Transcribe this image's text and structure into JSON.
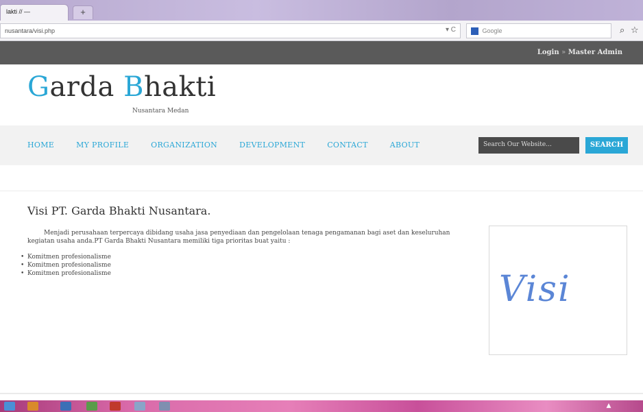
{
  "browser": {
    "tab_title": "lakti // —",
    "new_tab_label": "+",
    "url": "nusantara/visi.php",
    "url_controls": "▾ C",
    "search_placeholder": "Google",
    "search_engine_icon": "google-icon",
    "icons": [
      "find-icon",
      "star-icon"
    ]
  },
  "topbar": {
    "login_label": "Login",
    "separator": "»",
    "user_label": "Master Admin"
  },
  "header": {
    "brand_first_cap": "G",
    "brand_first_rest": "arda ",
    "brand_second_cap": "B",
    "brand_second_rest": "hakti",
    "tagline": "Nusantara Medan"
  },
  "menu": {
    "items": [
      "HOME",
      "MY PROFILE",
      "ORGANIZATION",
      "DEVELOPMENT",
      "CONTACT",
      "ABOUT"
    ]
  },
  "site_search": {
    "placeholder": "Search Our Website...",
    "button": "SEARCH"
  },
  "content": {
    "title": "Visi PT. Garda Bhakti Nusantara.",
    "paragraph": "Menjadi perusahaan terpercaya dibidang usaha jasa penyediaan dan pengelolaan tenaga pengamanan bagi aset dan keseluruhan kegiatan usaha anda.PT Garda Bhakti Nusantara memiliki tiga prioritas buat yaitu :",
    "bullets": [
      "Komitmen profesionalisme",
      "Komitmen profesionalisme",
      "Komitmen profesionalisme"
    ],
    "image_word": "Visi"
  },
  "colors": {
    "accent": "#2aa7d6",
    "topbar": "#5a5a5a",
    "visi_text": "#5b86d6"
  }
}
